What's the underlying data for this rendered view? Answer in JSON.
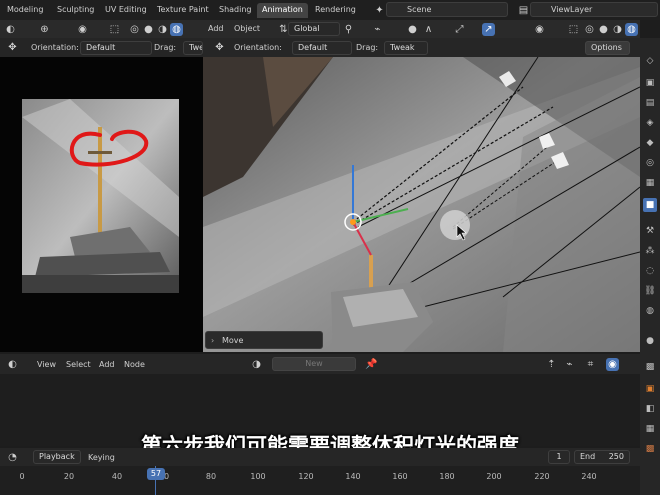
{
  "workspace_tabs": [
    "Modeling",
    "Sculpting",
    "UV Editing",
    "Texture Paint",
    "Shading",
    "Animation",
    "Rendering"
  ],
  "active_tab": "Animation",
  "scene_name": "Scene",
  "view_layer": "ViewLayer",
  "left_panel": {
    "orientation_label": "Orientation:",
    "orientation_value": "Default",
    "drag_label": "Drag:",
    "drag_value": "Twe"
  },
  "viewport": {
    "menu_add": "Add",
    "menu_object": "Object",
    "transform_space": "Global",
    "orientation_label": "Orientation:",
    "orientation_value": "Default",
    "drag_label": "Drag:",
    "drag_value": "Tweak",
    "options_label": "Options",
    "operator_panel": "Move"
  },
  "node_editor": {
    "menu_view": "View",
    "menu_select": "Select",
    "menu_add": "Add",
    "menu_node": "Node",
    "new_button": "New"
  },
  "timeline": {
    "playback_label": "Playback",
    "keying_label": "Keying",
    "current_frame": "57",
    "start_value": "1",
    "end_label": "End",
    "end_value": "250",
    "ruler": [
      "0",
      "20",
      "40",
      "60",
      "80",
      "100",
      "120",
      "140",
      "160",
      "180",
      "200",
      "220",
      "240"
    ]
  },
  "subtitle_text": "第六步我们可能需要调整体积灯光的强度",
  "icons": [
    "cursor-icon",
    "camera-icon",
    "link-icon",
    "snap-icon",
    "overlay-icon",
    "shading-sphere-icon",
    "pin-icon",
    "settings-icon"
  ]
}
